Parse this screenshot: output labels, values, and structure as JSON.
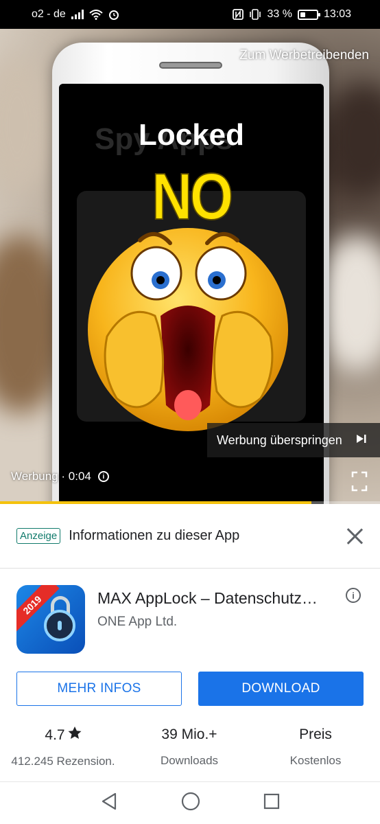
{
  "status_bar": {
    "carrier": "o2 - de",
    "battery": "33 %",
    "battery_level": 0.33,
    "time": "13:03"
  },
  "video": {
    "site_link": "Zum Werbetreibenden",
    "ghost_title": "Spy Apps",
    "screen_title": "Locked",
    "screen_big": "NO",
    "skip_label": "Werbung überspringen",
    "ad_timer": "Werbung · 0:04",
    "progress": 0.82
  },
  "ad_sheet": {
    "badge": "Anzeige",
    "title": "Informationen zu dieser App",
    "app": {
      "name": "MAX AppLock – Datenschutz…",
      "developer": "ONE App Ltd.",
      "ribbon": "2019"
    },
    "buttons": {
      "more_info": "MEHR INFOS",
      "download": "DOWNLOAD"
    },
    "stats": [
      {
        "top": "4.7",
        "bottom": "412.245 Rezension."
      },
      {
        "top": "39 Mio.+",
        "bottom": "Downloads"
      },
      {
        "top": "Preis",
        "bottom": "Kostenlos"
      }
    ]
  },
  "colors": {
    "accent": "#1a73e8",
    "anzeige_green": "#107a6b",
    "no_yellow": "#ffe200",
    "progress_yellow": "#f4c20d"
  },
  "icons": [
    "signal-icon",
    "wifi-icon",
    "alarm-icon",
    "nfc-icon",
    "vibrate-icon",
    "battery-icon",
    "star-icon",
    "info-icon",
    "close-icon",
    "skip-icon",
    "fullscreen-icon",
    "back-icon",
    "home-icon",
    "recents-icon"
  ]
}
